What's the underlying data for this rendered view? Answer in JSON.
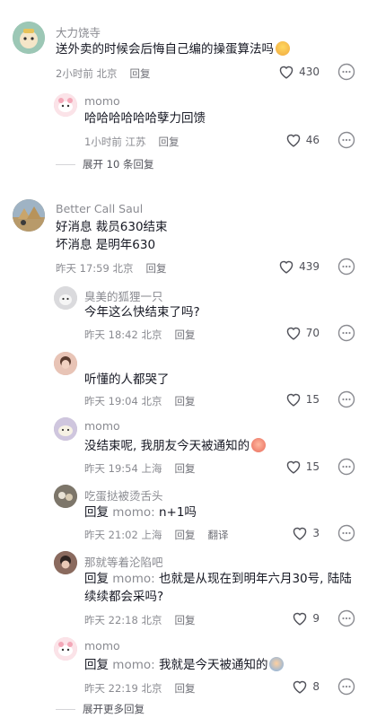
{
  "comments": [
    {
      "username": "大力饶寺",
      "text": "送外卖的时候会后悔自己编的操蛋算法吗",
      "time": "2小时前 北京",
      "reply_label": "回复",
      "likes": "430",
      "avatar_color": "#7fb3a2",
      "replies": [
        {
          "username": "momo",
          "text": "哈哈哈哈哈哈孽力回馈",
          "time": "1小时前 江苏",
          "reply_label": "回复",
          "likes": "46",
          "avatar_color": "#f3c7d0"
        }
      ],
      "expand_label": "展开 10 条回复"
    },
    {
      "username": "Better Call Saul",
      "text_lines": [
        "好消息 裁员630结束",
        "坏消息 是明年630"
      ],
      "time": "昨天 17:59 北京",
      "reply_label": "回复",
      "likes": "439",
      "avatar_color": "#8b7a5a",
      "replies": [
        {
          "username": "臭美的狐狸一只",
          "text": "今年这么快结束了吗?",
          "time": "昨天 18:42 北京",
          "reply_label": "回复",
          "likes": "70",
          "avatar_color": "#cfcfd2"
        },
        {
          "username": "",
          "text": "听懂的人都哭了",
          "time": "昨天 19:04 北京",
          "reply_label": "回复",
          "likes": "15",
          "avatar_color": "#d9a89a"
        },
        {
          "username": "momo",
          "text": "没结束呢, 我朋友今天被通知的",
          "time": "昨天 19:54 上海",
          "reply_label": "回复",
          "likes": "15",
          "avatar_color": "#b9b0c8"
        },
        {
          "username": "吃蛋挞被烫舌头",
          "reply_prefix": "回复",
          "reply_to": "momo:",
          "text": "n+1吗",
          "time": "昨天 21:02 上海",
          "reply_label": "回复",
          "translate_label": "翻译",
          "likes": "3",
          "avatar_color": "#6f6a60"
        },
        {
          "username": "那就等着沦陷吧",
          "reply_prefix": "回复",
          "reply_to": "momo:",
          "text": "也就是从现在到明年六月30号, 陆陆",
          "text_line2": "续续都会采吗?",
          "time": "昨天 22:18 北京",
          "reply_label": "回复",
          "likes": "9",
          "avatar_color": "#7a5c52"
        },
        {
          "username": "momo",
          "reply_prefix": "回复",
          "reply_to": "momo:",
          "text": "我就是今天被通知的",
          "time": "昨天 22:19 北京",
          "reply_label": "回复",
          "likes": "8",
          "avatar_color": "#f3c7d0"
        }
      ],
      "expand_label": "展开更多回复"
    }
  ],
  "icons": {
    "like": "heart-outline-icon",
    "more": "more-dots-circle-icon"
  }
}
